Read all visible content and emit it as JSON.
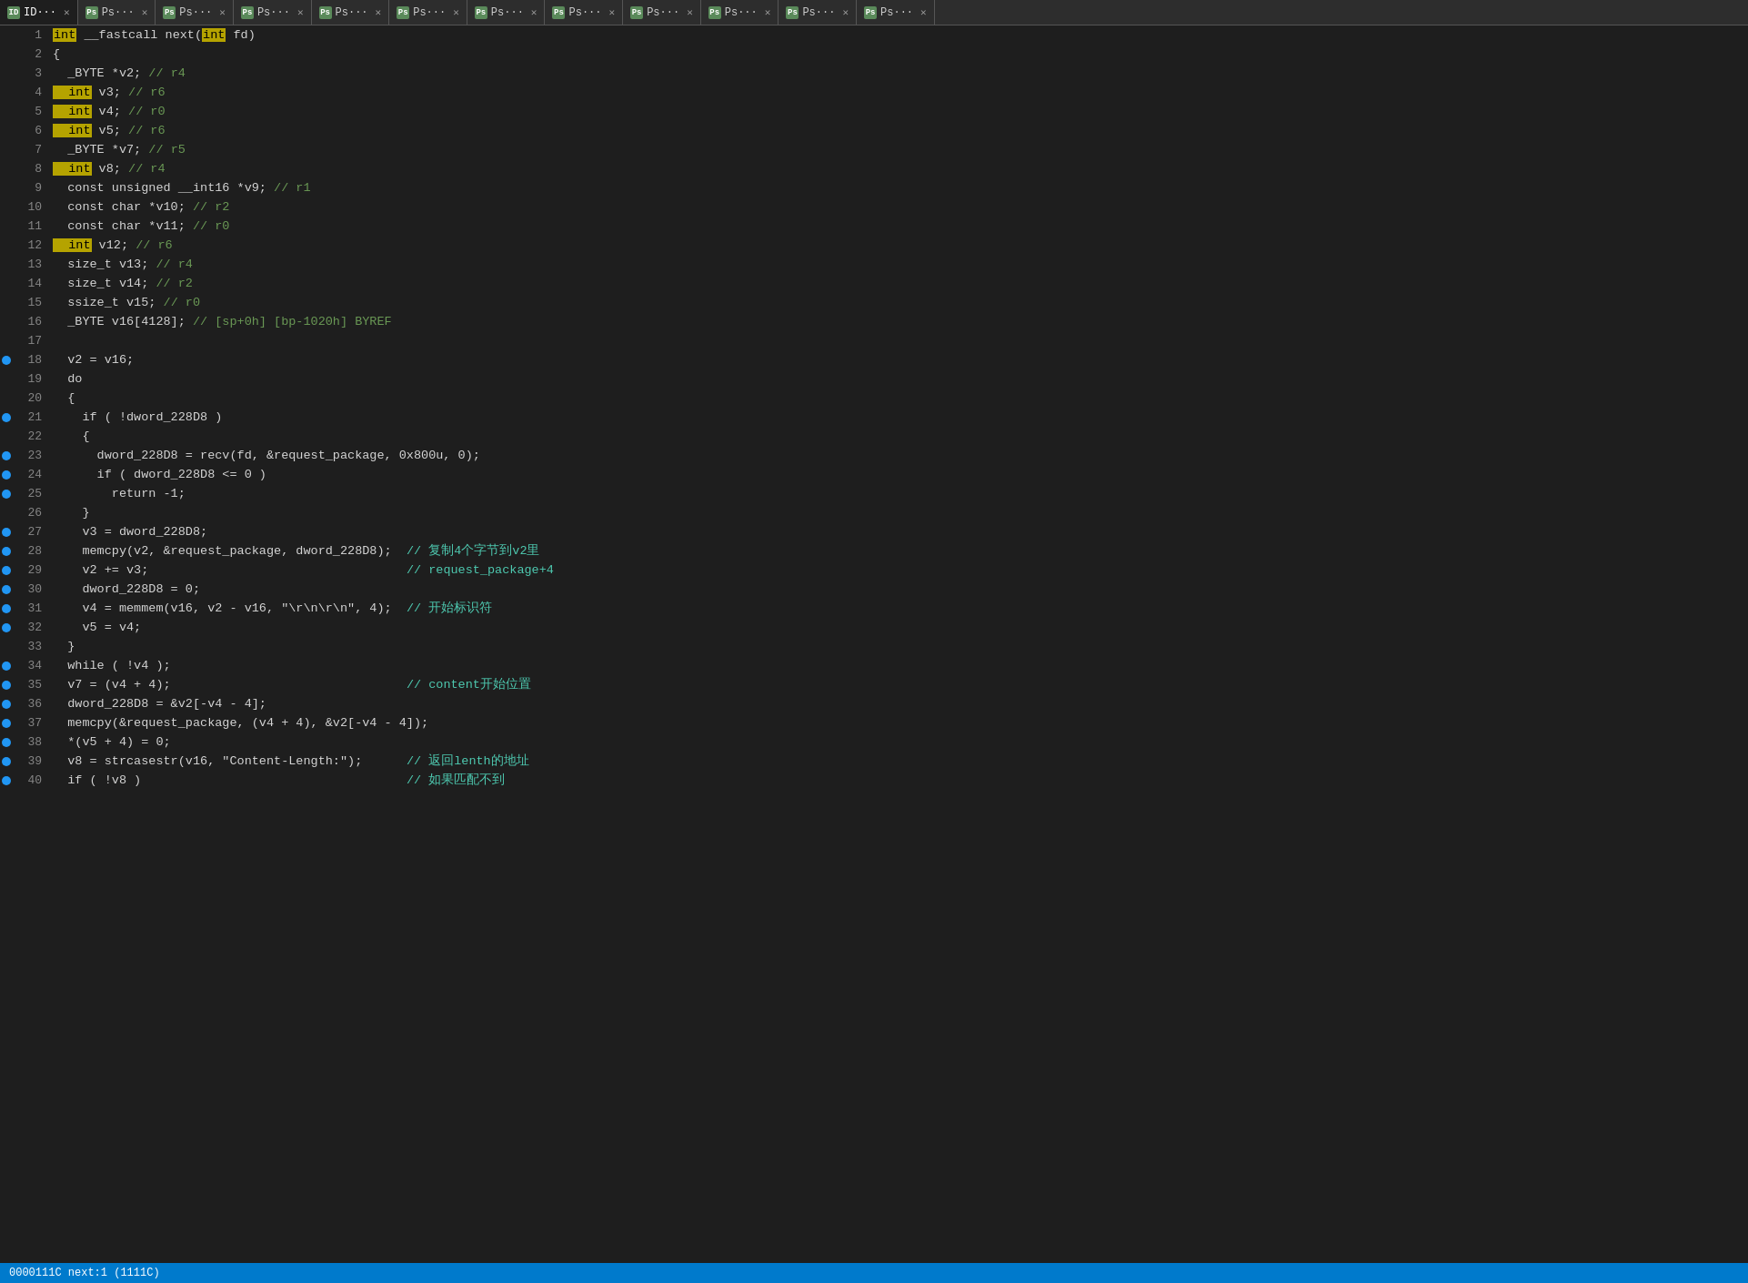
{
  "tabs": [
    {
      "id": "ID",
      "label": "ID···",
      "active": true,
      "closable": true
    },
    {
      "id": "Ps1",
      "label": "Ps···",
      "active": false,
      "closable": true
    },
    {
      "id": "Ps2",
      "label": "Ps···",
      "active": false,
      "closable": true
    },
    {
      "id": "Ps3",
      "label": "Ps···",
      "active": false,
      "closable": true
    },
    {
      "id": "Ps4",
      "label": "Ps···",
      "active": false,
      "closable": true
    },
    {
      "id": "Ps5",
      "label": "Ps···",
      "active": false,
      "closable": true
    },
    {
      "id": "Ps6",
      "label": "Ps···",
      "active": false,
      "closable": true
    },
    {
      "id": "Ps7",
      "label": "Ps···",
      "active": false,
      "closable": true
    },
    {
      "id": "Ps8",
      "label": "Ps···",
      "active": false,
      "closable": true
    },
    {
      "id": "Ps9",
      "label": "Ps···",
      "active": false,
      "closable": true
    },
    {
      "id": "Ps10",
      "label": "Ps···",
      "active": false,
      "closable": true
    },
    {
      "id": "Ps11",
      "label": "Ps···",
      "active": false,
      "closable": true
    }
  ],
  "status_bar": {
    "text": "0000111C next:1 (1111C)"
  }
}
